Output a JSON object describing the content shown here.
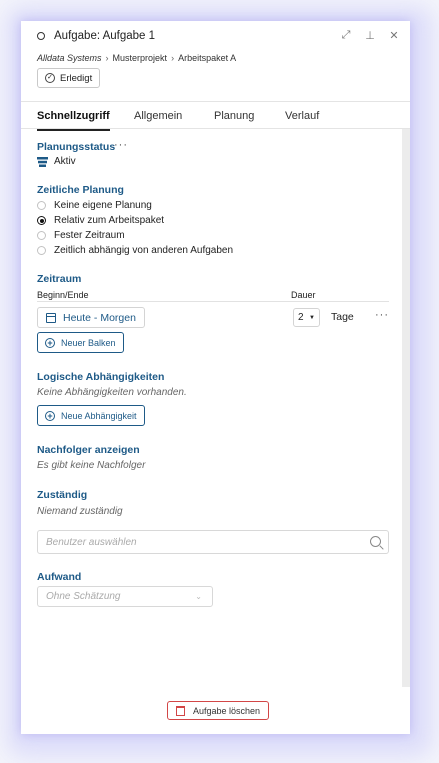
{
  "window": {
    "title": "Aufgabe: Aufgabe 1",
    "expand_icon": "expand-icon",
    "pin_icon": "pin-icon",
    "close_icon": "close-icon",
    "close_glyph": "✕"
  },
  "breadcrumb": {
    "org": "Alldata Systems",
    "separator": "›",
    "project": "Musterprojekt",
    "workpackage": "Arbeitspaket A"
  },
  "done_button": {
    "label": "Erledigt"
  },
  "tabs": [
    {
      "label": "Schnellzugriff",
      "active": true
    },
    {
      "label": "Allgemein",
      "active": false
    },
    {
      "label": "Planung",
      "active": false
    },
    {
      "label": "Verlauf",
      "active": false
    }
  ],
  "planungsstatus": {
    "title": "Planungsstatus",
    "more": "···",
    "value": "Aktiv"
  },
  "zeitliche_planung": {
    "title": "Zeitliche Planung",
    "options": [
      {
        "label": "Keine eigene Planung",
        "checked": false
      },
      {
        "label": "Relativ zum Arbeitspaket",
        "checked": true
      },
      {
        "label": "Fester Zeitraum",
        "checked": false
      },
      {
        "label": "Zeitlich abhängig von anderen Aufgaben",
        "checked": false
      }
    ]
  },
  "zeitraum": {
    "title": "Zeitraum",
    "col_begin": "Beginn/Ende",
    "col_duration": "Dauer",
    "date_value": "Heute - Morgen",
    "duration_value": "2",
    "duration_unit": "Tage",
    "more": "···",
    "new_bar_button": "Neuer Balken"
  },
  "abhaengigkeiten": {
    "title": "Logische Abhängigkeiten",
    "empty_text": "Keine Abhängigkeiten vorhanden.",
    "new_button": "Neue Abhängigkeit"
  },
  "nachfolger": {
    "title": "Nachfolger anzeigen",
    "empty_text": "Es gibt keine Nachfolger"
  },
  "zustaendig": {
    "title": "Zuständig",
    "empty_text": "Niemand zuständig",
    "input_placeholder": "Benutzer auswählen"
  },
  "aufwand": {
    "title": "Aufwand",
    "select_placeholder": "Ohne Schätzung"
  },
  "footer": {
    "delete_button": "Aufgabe löschen"
  },
  "colors": {
    "accent": "#1e5a87",
    "danger": "#d24646"
  }
}
